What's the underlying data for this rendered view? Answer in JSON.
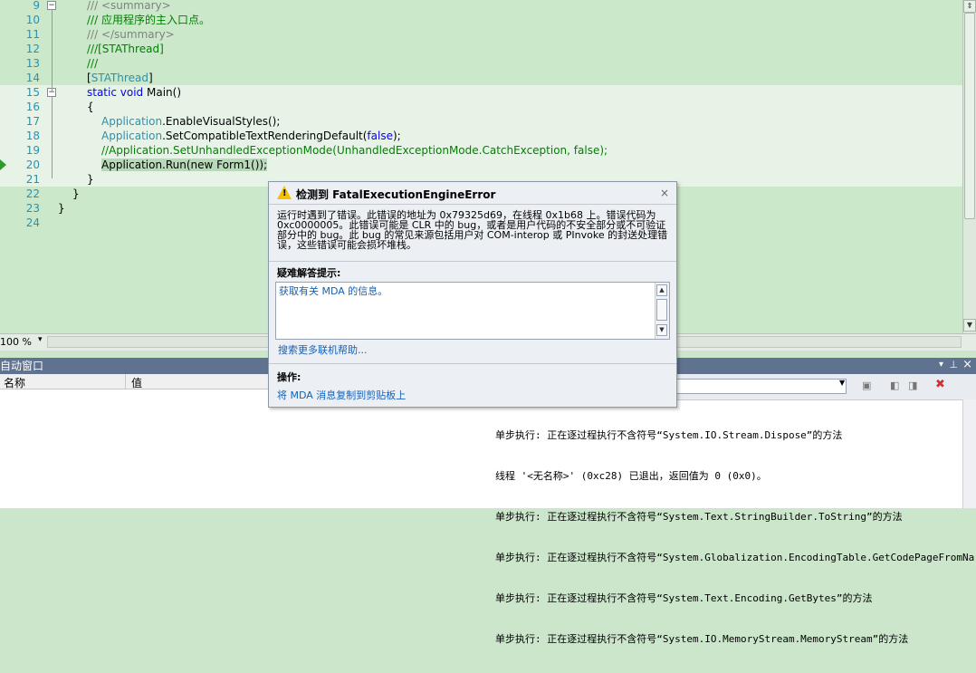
{
  "editor": {
    "lines": [
      {
        "num": "9",
        "parts": [
          {
            "t": "/// <summary>",
            "c": "c-gray"
          }
        ]
      },
      {
        "num": "10",
        "parts": [
          {
            "t": "/// 应用程序的主入口点。",
            "c": "c-green"
          }
        ]
      },
      {
        "num": "11",
        "parts": [
          {
            "t": "/// </summary>",
            "c": "c-gray"
          }
        ]
      },
      {
        "num": "12",
        "parts": [
          {
            "t": "///[STAThread]",
            "c": "c-green"
          }
        ]
      },
      {
        "num": "13",
        "parts": [
          {
            "t": "///",
            "c": "c-green"
          }
        ]
      },
      {
        "num": "14",
        "parts": [
          {
            "t": "[",
            "c": ""
          },
          {
            "t": "STAThread",
            "c": "c-teal"
          },
          {
            "t": "]",
            "c": ""
          }
        ]
      },
      {
        "num": "15",
        "parts": [
          {
            "t": "static void ",
            "c": "c-blue"
          },
          {
            "t": "Main()",
            "c": ""
          }
        ]
      },
      {
        "num": "16",
        "parts": [
          {
            "t": "{",
            "c": ""
          }
        ]
      },
      {
        "num": "17",
        "parts": [
          {
            "t": "Application",
            "c": "c-teal"
          },
          {
            "t": ".EnableVisualStyles();",
            "c": ""
          }
        ]
      },
      {
        "num": "18",
        "parts": [
          {
            "t": "Application",
            "c": "c-teal"
          },
          {
            "t": ".SetCompatibleTextRenderingDefault(",
            "c": ""
          },
          {
            "t": "false",
            "c": "c-blue"
          },
          {
            "t": ");",
            "c": ""
          }
        ]
      },
      {
        "num": "19",
        "parts": [
          {
            "t": "//Application.SetUnhandledExceptionMode(UnhandledExceptionMode.CatchException, false);",
            "c": "c-green"
          }
        ]
      },
      {
        "num": "20",
        "parts": [
          {
            "t": "Application.Run(new Form1());",
            "c": "hl"
          }
        ]
      },
      {
        "num": "21",
        "parts": [
          {
            "t": "}",
            "c": ""
          }
        ]
      },
      {
        "num": "22",
        "parts": [
          {
            "t": "}",
            "c": ""
          }
        ]
      },
      {
        "num": "23",
        "parts": [
          {
            "t": "}",
            "c": ""
          }
        ]
      },
      {
        "num": "24",
        "parts": []
      }
    ]
  },
  "zoom": "100 %",
  "autos": {
    "title": "自动窗口",
    "col_name": "名称",
    "col_value": "值"
  },
  "output": {
    "lines": [
      "单步执行: 正在逐过程执行不含符号“System.IO.Stream.Dispose”的方法",
      "线程 '<无名称>' (0xc28) 已退出，返回值为 0 (0x0)。",
      "单步执行: 正在逐过程执行不含符号“System.Text.StringBuilder.ToString”的方法",
      "单步执行: 正在逐过程执行不含符号“System.Globalization.EncodingTable.GetCodePageFromNa",
      "单步执行: 正在逐过程执行不含符号“System.Text.Encoding.GetBytes”的方法",
      "单步执行: 正在逐过程执行不含符号“System.IO.MemoryStream.MemoryStream”的方法"
    ]
  },
  "mda": {
    "title": "检测到 FatalExecutionEngineError",
    "close": "×",
    "message": "运行时遇到了错误。此错误的地址为 0x79325d69，在线程 0x1b68 上。错误代码为 0xc0000005。此错误可能是 CLR 中的 bug，或者是用户代码的不安全部分或不可验证部分中的 bug。此 bug 的常见来源包括用户对 COM-interop 或 PInvoke 的封送处理错误，这些错误可能会损坏堆栈。",
    "tips_label": "疑难解答提示:",
    "tip_link": "获取有关 MDA 的信息。",
    "more_help": "搜索更多联机帮助...",
    "actions_label": "操作:",
    "copy_link": "将 MDA 消息复制到剪贴板上"
  }
}
